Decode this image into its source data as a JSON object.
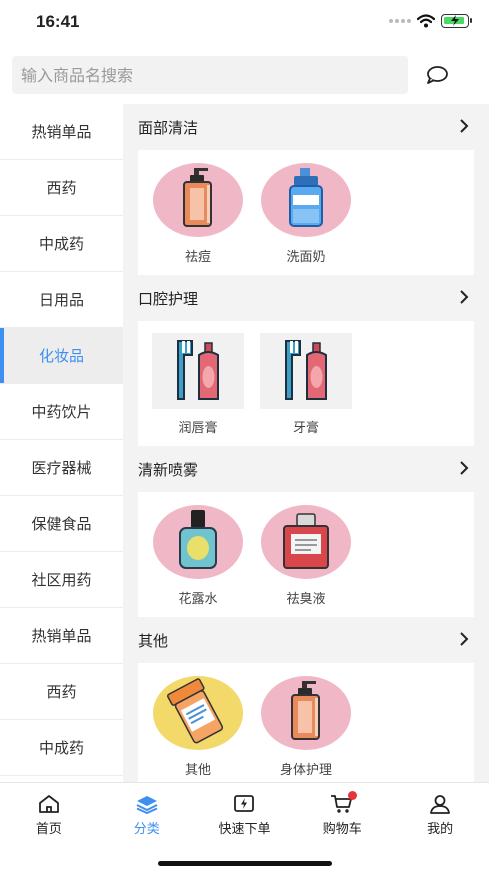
{
  "status_bar": {
    "time": "16:41"
  },
  "search": {
    "placeholder": "输入商品名搜索",
    "value": ""
  },
  "sidebar": {
    "items": [
      {
        "label": "热销单品",
        "active": false
      },
      {
        "label": "西药",
        "active": false
      },
      {
        "label": "中成药",
        "active": false
      },
      {
        "label": "日用品",
        "active": false
      },
      {
        "label": "化妆品",
        "active": true
      },
      {
        "label": "中药饮片",
        "active": false
      },
      {
        "label": "医疗器械",
        "active": false
      },
      {
        "label": "保健食品",
        "active": false
      },
      {
        "label": "社区用药",
        "active": false
      },
      {
        "label": "热销单品",
        "active": false
      },
      {
        "label": "西药",
        "active": false
      },
      {
        "label": "中成药",
        "active": false
      }
    ]
  },
  "sections": [
    {
      "title": "面部清洁",
      "products": [
        {
          "name": "祛痘",
          "icon": "pump-bottle-icon"
        },
        {
          "name": "洗面奶",
          "icon": "blue-bottle-icon"
        }
      ]
    },
    {
      "title": "口腔护理",
      "products": [
        {
          "name": "润唇膏",
          "icon": "toothbrush-toothpaste-icon"
        },
        {
          "name": "牙膏",
          "icon": "toothbrush-toothpaste-icon"
        }
      ]
    },
    {
      "title": "清新喷雾",
      "products": [
        {
          "name": "花露水",
          "icon": "perfume-bottle-icon"
        },
        {
          "name": "祛臭液",
          "icon": "red-bottle-icon"
        }
      ]
    },
    {
      "title": "其他",
      "products": [
        {
          "name": "其他",
          "icon": "pill-bottle-icon"
        },
        {
          "name": "身体护理",
          "icon": "pump-bottle-icon"
        }
      ]
    }
  ],
  "tabbar": {
    "tabs": [
      {
        "label": "首页",
        "icon": "home-icon",
        "active": false
      },
      {
        "label": "分类",
        "icon": "layers-icon",
        "active": true
      },
      {
        "label": "快速下单",
        "icon": "lightning-icon",
        "active": false
      },
      {
        "label": "购物车",
        "icon": "cart-icon",
        "active": false,
        "badge_dot": true
      },
      {
        "label": "我的",
        "icon": "user-icon",
        "active": false
      }
    ]
  },
  "colors": {
    "accent": "#3d8ff0",
    "pink_circle": "#f0b8c6",
    "yellow_circle": "#f3d96a",
    "badge": "#e8333a"
  }
}
